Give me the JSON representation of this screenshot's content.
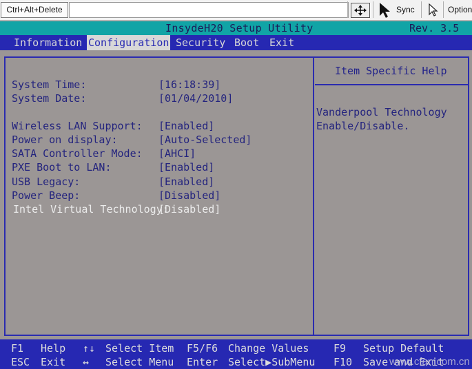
{
  "toolbar": {
    "ctrl_alt_delete": "Ctrl+Alt+Delete",
    "sync": "Sync",
    "options": "Options"
  },
  "bios": {
    "title": "InsydeH20 Setup Utility",
    "revision": "Rev. 3.5",
    "menu": [
      "Information",
      "Configuration",
      "Security",
      "Boot",
      "Exit"
    ],
    "active_menu": "Configuration",
    "system_time_label": "System Time:",
    "system_time_value": "[16:18:39]",
    "system_date_label": "System Date:",
    "system_date_value": "[01/04/2010]",
    "settings": [
      {
        "label": "Wireless LAN Support:",
        "value": "[Enabled]"
      },
      {
        "label": "Power on display:",
        "value": "[Auto-Selected]"
      },
      {
        "label": "SATA Controller Mode:",
        "value": "[AHCI]"
      },
      {
        "label": "PXE Boot to LAN:",
        "value": "[Enabled]"
      },
      {
        "label": "USB Legacy:",
        "value": "[Enabled]"
      },
      {
        "label": "Power Beep:",
        "value": "[Disabled]"
      },
      {
        "label": "Intel Virtual Technology:",
        "value": "[Disabled]"
      }
    ],
    "help_title": "Item Specific Help",
    "help_text": [
      "Vanderpool Technology",
      "Enable/Disable."
    ]
  },
  "footer": {
    "f1_key": "F1",
    "f1_label": "Help",
    "updown_key": "↑↓",
    "updown_label": "Select Item",
    "f5f6_key": "F5/F6",
    "f5f6_label": "Change Values",
    "f9_key": "F9",
    "f9_label": "Setup Default",
    "esc_key": "ESC",
    "esc_label": "Exit",
    "leftright_key": "↔",
    "leftright_label": "Select Menu",
    "enter_key": "Enter",
    "enter_label": "Select▶SubMenu",
    "f10_key": "F10",
    "f10_label": "Save and Exit"
  },
  "watermark": "www.cfan.com.cn",
  "colors": {
    "background": "#9b9695",
    "title_bar": "#11a4a6",
    "menu_bar": "#2628b2",
    "text_blue": "#24247e",
    "highlight": "#ececec"
  }
}
